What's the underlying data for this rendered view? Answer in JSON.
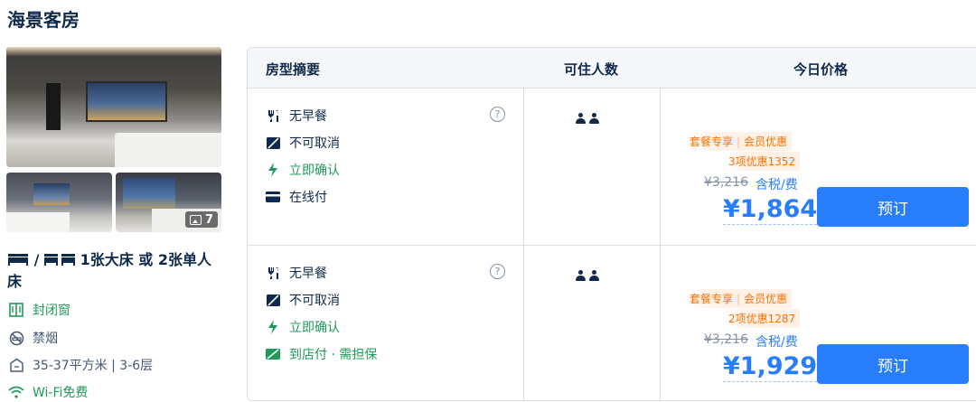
{
  "section_title": "海景客房",
  "photos": {
    "count": "7"
  },
  "room": {
    "bed_separator": "/",
    "bed_text": "1张大床 或 2张单人床",
    "attributes": [
      {
        "icon": "window-icon",
        "text": "封闭窗"
      },
      {
        "icon": "no-smoking-icon",
        "text": "禁烟"
      },
      {
        "icon": "area-icon",
        "text": "35-37平方米 | 3-6层"
      },
      {
        "icon": "wifi-icon",
        "text": "Wi-Fi免费"
      }
    ]
  },
  "table": {
    "headers": [
      "房型摘要",
      "可住人数",
      "今日价格"
    ],
    "help_symbol": "?",
    "rows": [
      {
        "policies": [
          {
            "icon": "fork-knife-icon",
            "text": "无早餐"
          },
          {
            "icon": "no-cancel-icon",
            "text": "不可取消"
          },
          {
            "icon": "lightning-icon",
            "text": "立即确认"
          },
          {
            "icon": "card-icon",
            "text": "在线付"
          }
        ],
        "promo_a": "套餐专享",
        "promo_b": "会员优惠",
        "promo_detail": "3项优惠1352",
        "original_price": "¥3,216",
        "tax_note": "含税/费",
        "price": "¥1,864",
        "book_label": "预订"
      },
      {
        "policies": [
          {
            "icon": "fork-knife-icon",
            "text": "无早餐"
          },
          {
            "icon": "no-cancel-icon",
            "text": "不可取消"
          },
          {
            "icon": "lightning-icon",
            "text": "立即确认"
          },
          {
            "icon": "pay-at-hotel-icon",
            "text": "到店付 · 需担保"
          }
        ],
        "promo_a": "套餐专享",
        "promo_b": "会员优惠",
        "promo_detail": "2项优惠1287",
        "original_price": "¥3,216",
        "tax_note": "含税/费",
        "price": "¥1,929",
        "book_label": "预订"
      }
    ]
  },
  "colors": {
    "accent": "#287dfa",
    "promo": "#ff6f00",
    "green": "#1f9a5a",
    "text": "#0f294d"
  }
}
